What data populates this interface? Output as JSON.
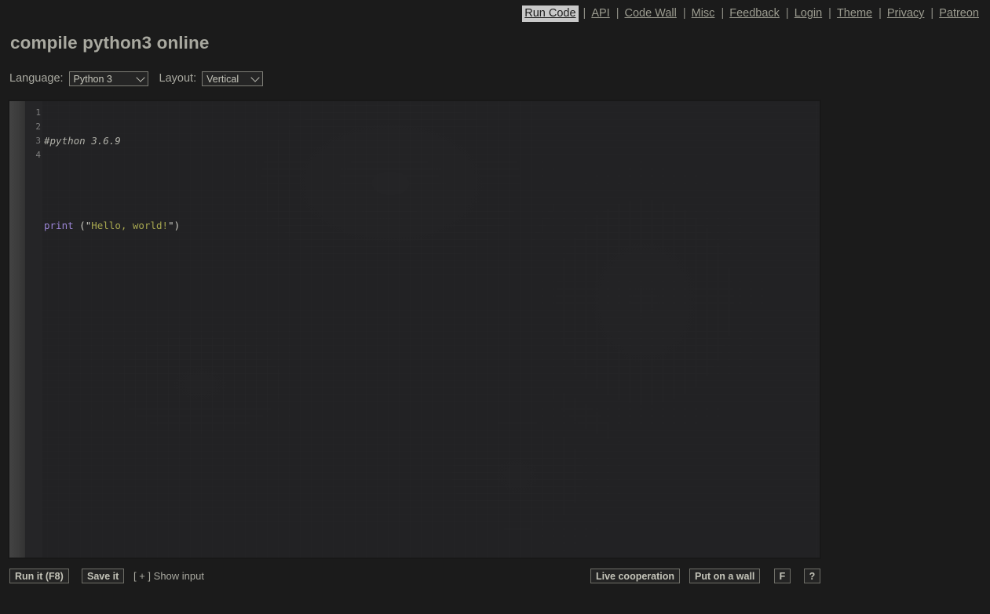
{
  "nav": {
    "items": [
      {
        "label": "Run Code",
        "active": true
      },
      {
        "label": "API",
        "active": false
      },
      {
        "label": "Code Wall",
        "active": false
      },
      {
        "label": "Misc",
        "active": false
      },
      {
        "label": "Feedback",
        "active": false
      },
      {
        "label": "Login",
        "active": false
      },
      {
        "label": "Theme",
        "active": false
      },
      {
        "label": "Privacy",
        "active": false
      },
      {
        "label": "Patreon",
        "active": false
      }
    ],
    "separator": "|"
  },
  "header": {
    "title": "compile python3 online"
  },
  "controls": {
    "language_label": "Language:",
    "language_value": "Python 3",
    "language_options": [
      "Python 3"
    ],
    "layout_label": "Layout:",
    "layout_value": "Vertical",
    "layout_options": [
      "Vertical"
    ]
  },
  "editor": {
    "line_numbers": [
      "1",
      "2",
      "3",
      "4"
    ],
    "lines": [
      {
        "comment": "#python 3.6.9"
      },
      {
        "blank": ""
      },
      {
        "func": "print",
        "open": " (\"",
        "string": "Hello, world!",
        "close": "\")"
      },
      {
        "blank": ""
      }
    ],
    "code_plain": "#python 3.6.9\n\nprint (\"Hello, world!\")\n"
  },
  "bottom": {
    "run_label": "Run it (F8)",
    "save_label": "Save it",
    "show_input_label": "[ + ] Show input",
    "live_label": "Live cooperation",
    "wall_label": "Put on a wall",
    "fullscreen_label": "F",
    "help_label": "?"
  },
  "colors": {
    "page_background": "#1b1b1b",
    "editor_background": "#222224",
    "gutter_background": "#252527",
    "strip_background": "#3b3b3b",
    "link": "#9c9c90",
    "active_nav_background": "#c9c9c9",
    "title": "#a9a9a0",
    "button_border": "#6f6f68",
    "syntax_comment": "#b0b0a8",
    "syntax_function": "#9a84d4",
    "syntax_string": "#a6a64f",
    "line_number": "#7e7e7e"
  }
}
